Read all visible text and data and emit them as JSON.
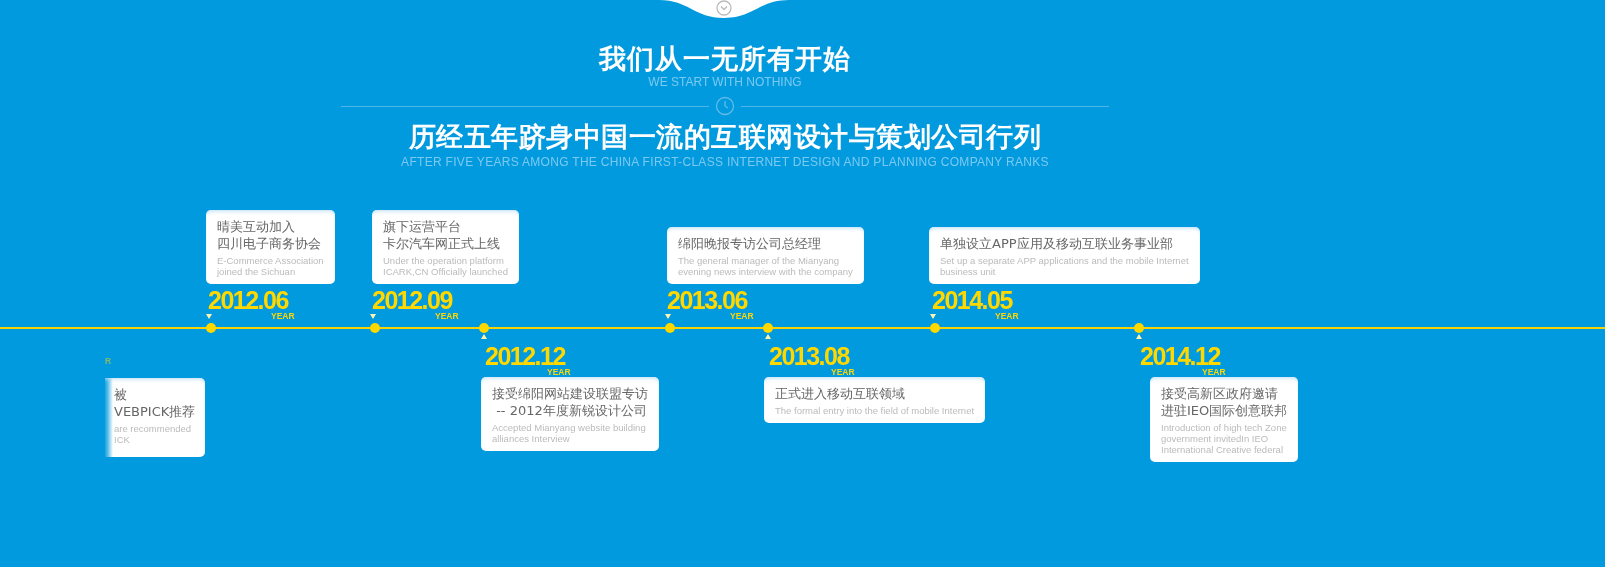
{
  "heading": {
    "title": "我们从一无所有开始",
    "subtitle": "WE START WITH NOTHING"
  },
  "tagline": {
    "title": "历经五年跻身中国一流的互联网设计与策划公司行列",
    "subtitle": "AFTER FIVE YEARS AMONG THE CHINA FIRST-CLASS INTERNET DESIGN AND PLANNING COMPANY RANKS"
  },
  "timeline": [
    {
      "kind": "partial",
      "year": "R",
      "title": [
        "被",
        "VEBPICK推荐"
      ],
      "desc": "are recommended\nICK"
    },
    {
      "kind": "above",
      "date": "2012.06",
      "year": "YEAR",
      "title": [
        "晴美互动加入",
        "四川电子商务协会"
      ],
      "desc": "E-Commerce Association\njoined the Sichuan"
    },
    {
      "kind": "above",
      "date": "2012.09",
      "year": "YEAR",
      "title": [
        "旗下运营平台",
        "卡尔汽车网正式上线"
      ],
      "desc": "Under the operation platform\nICARK,CN Officially launched"
    },
    {
      "kind": "below",
      "date": "2012.12",
      "year": "YEAR",
      "title": [
        "接受绵阳网站建设联盟专访",
        " -- 2012年度新锐设计公司"
      ],
      "desc": "Accepted Mianyang website building\nalliances Interview"
    },
    {
      "kind": "above",
      "date": "2013.06",
      "year": "YEAR",
      "title": [
        "绵阳晚报专访公司总经理"
      ],
      "desc": "The general manager of the Mianyang\nevening news interview with the company"
    },
    {
      "kind": "below",
      "date": "2013.08",
      "year": "YEAR",
      "title": [
        "正式进入移动互联领域"
      ],
      "desc": "The formal entry into the field of mobile Internet"
    },
    {
      "kind": "above",
      "date": "2014.05",
      "year": "YEAR",
      "title": [
        "单独设立APP应用及移动互联业务事业部"
      ],
      "desc": "Set up a separate APP applications and the mobile Internet\nbusiness unit"
    },
    {
      "kind": "below",
      "date": "2014.12",
      "year": "YEAR",
      "title": [
        "接受高新区政府邀请",
        "进驻IEO国际创意联邦"
      ],
      "desc": "Introduction of high tech Zone\ngovernment invitedIn IEO\nInternational Creative federal"
    }
  ]
}
